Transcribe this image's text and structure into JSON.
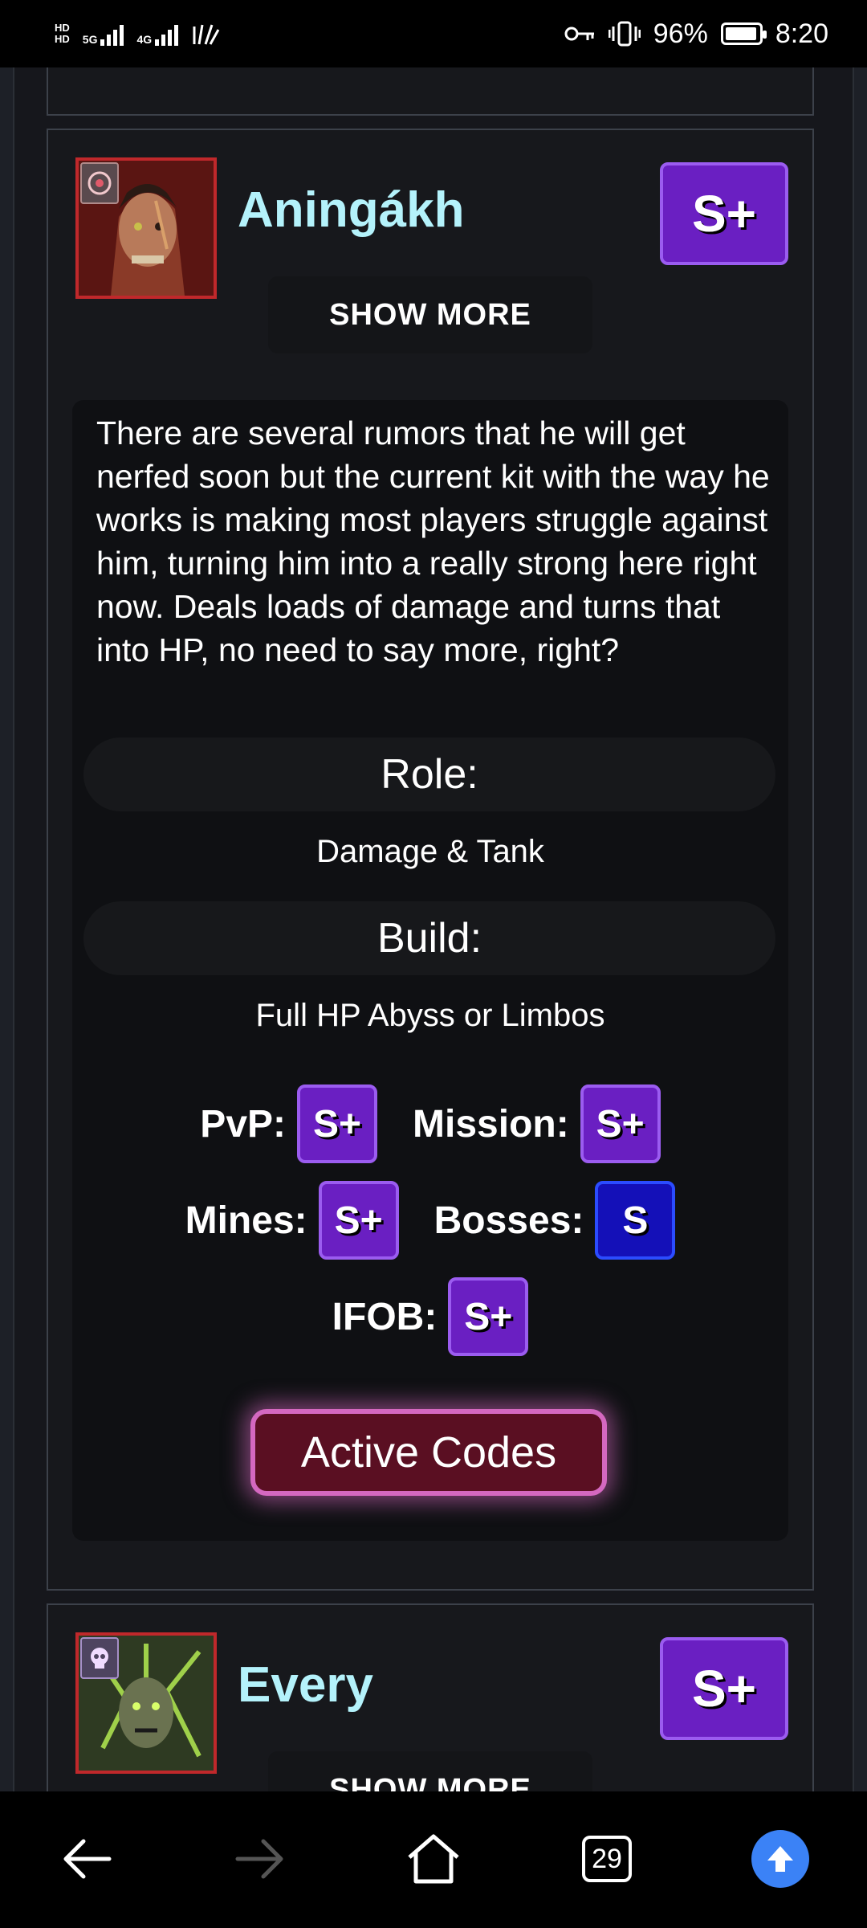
{
  "status_bar": {
    "network_1": "5G",
    "network_2": "4G",
    "battery": "96%",
    "time": "8:20"
  },
  "hero": {
    "name": "Aningákh",
    "tier": "S+",
    "show_more": "SHOW MORE",
    "description": "There are several rumors that he will get nerfed soon but the current kit with the way he works is making most players struggle against him, turning him into a really strong here right now. Deals loads of damage and turns that into HP, no need to say more, right?",
    "role_label": "Role:",
    "role_value": "Damage & Tank",
    "build_label": "Build:",
    "build_value": "Full HP Abyss or Limbos",
    "ratings": {
      "pvp": {
        "label": "PvP:",
        "value": "S+"
      },
      "mission": {
        "label": "Mission:",
        "value": "S+"
      },
      "mines": {
        "label": "Mines:",
        "value": "S+"
      },
      "bosses": {
        "label": "Bosses:",
        "value": "S"
      },
      "ifob": {
        "label": "IFOB:",
        "value": "S+"
      }
    },
    "codes_button": "Active Codes"
  },
  "next_hero": {
    "name": "Every",
    "tier": "S+",
    "show_more": "SHOW MORE"
  },
  "nav_bar": {
    "tabs_count": "29"
  },
  "colors": {
    "hero_name": "#b4f2fb",
    "tier_purple": "#6a1fc2",
    "tier_blue": "#1410b8",
    "codes_glow": "#d468c0",
    "portrait_border": "#c0282b"
  }
}
